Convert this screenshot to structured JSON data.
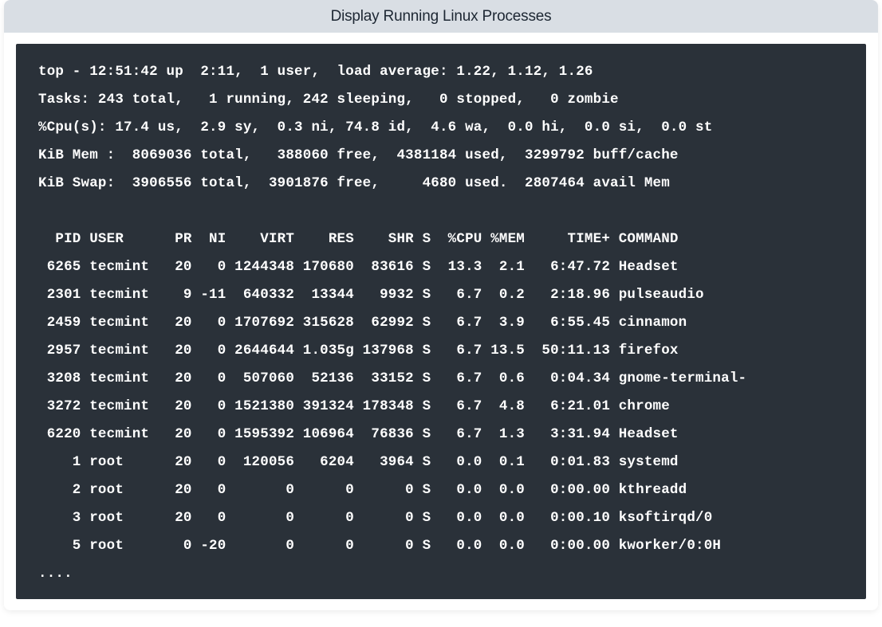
{
  "header": {
    "title": "Display Running Linux Processes"
  },
  "terminal": {
    "summary": {
      "line1": "top - 12:51:42 up  2:11,  1 user,  load average: 1.22, 1.12, 1.26",
      "line2": "Tasks: 243 total,   1 running, 242 sleeping,   0 stopped,   0 zombie",
      "line3": "%Cpu(s): 17.4 us,  2.9 sy,  0.3 ni, 74.8 id,  4.6 wa,  0.0 hi,  0.0 si,  0.0 st",
      "line4": "KiB Mem :  8069036 total,   388060 free,  4381184 used,  3299792 buff/cache",
      "line5": "KiB Swap:  3906556 total,  3901876 free,     4680 used.  2807464 avail Mem"
    },
    "columns": [
      "PID",
      "USER",
      "PR",
      "NI",
      "VIRT",
      "RES",
      "SHR",
      "S",
      "%CPU",
      "%MEM",
      "TIME+",
      "COMMAND"
    ],
    "header_row": "  PID USER      PR  NI    VIRT    RES    SHR S  %CPU %MEM     TIME+ COMMAND",
    "processes": [
      {
        "pid": 6265,
        "user": "tecmint",
        "pr": 20,
        "ni": 0,
        "virt": "1244348",
        "res": "170680",
        "shr": "83616",
        "s": "S",
        "cpu": "13.3",
        "mem": "2.1",
        "time": "6:47.72",
        "command": "Headset"
      },
      {
        "pid": 2301,
        "user": "tecmint",
        "pr": 9,
        "ni": -11,
        "virt": "640332",
        "res": "13344",
        "shr": "9932",
        "s": "S",
        "cpu": "6.7",
        "mem": "0.2",
        "time": "2:18.96",
        "command": "pulseaudio"
      },
      {
        "pid": 2459,
        "user": "tecmint",
        "pr": 20,
        "ni": 0,
        "virt": "1707692",
        "res": "315628",
        "shr": "62992",
        "s": "S",
        "cpu": "6.7",
        "mem": "3.9",
        "time": "6:55.45",
        "command": "cinnamon"
      },
      {
        "pid": 2957,
        "user": "tecmint",
        "pr": 20,
        "ni": 0,
        "virt": "2644644",
        "res": "1.035g",
        "shr": "137968",
        "s": "S",
        "cpu": "6.7",
        "mem": "13.5",
        "time": "50:11.13",
        "command": "firefox"
      },
      {
        "pid": 3208,
        "user": "tecmint",
        "pr": 20,
        "ni": 0,
        "virt": "507060",
        "res": "52136",
        "shr": "33152",
        "s": "S",
        "cpu": "6.7",
        "mem": "0.6",
        "time": "0:04.34",
        "command": "gnome-terminal-"
      },
      {
        "pid": 3272,
        "user": "tecmint",
        "pr": 20,
        "ni": 0,
        "virt": "1521380",
        "res": "391324",
        "shr": "178348",
        "s": "S",
        "cpu": "6.7",
        "mem": "4.8",
        "time": "6:21.01",
        "command": "chrome"
      },
      {
        "pid": 6220,
        "user": "tecmint",
        "pr": 20,
        "ni": 0,
        "virt": "1595392",
        "res": "106964",
        "shr": "76836",
        "s": "S",
        "cpu": "6.7",
        "mem": "1.3",
        "time": "3:31.94",
        "command": "Headset"
      },
      {
        "pid": 1,
        "user": "root",
        "pr": 20,
        "ni": 0,
        "virt": "120056",
        "res": "6204",
        "shr": "3964",
        "s": "S",
        "cpu": "0.0",
        "mem": "0.1",
        "time": "0:01.83",
        "command": "systemd"
      },
      {
        "pid": 2,
        "user": "root",
        "pr": 20,
        "ni": 0,
        "virt": "0",
        "res": "0",
        "shr": "0",
        "s": "S",
        "cpu": "0.0",
        "mem": "0.0",
        "time": "0:00.00",
        "command": "kthreadd"
      },
      {
        "pid": 3,
        "user": "root",
        "pr": 20,
        "ni": 0,
        "virt": "0",
        "res": "0",
        "shr": "0",
        "s": "S",
        "cpu": "0.0",
        "mem": "0.0",
        "time": "0:00.10",
        "command": "ksoftirqd/0"
      },
      {
        "pid": 5,
        "user": "root",
        "pr": 0,
        "ni": -20,
        "virt": "0",
        "res": "0",
        "shr": "0",
        "s": "S",
        "cpu": "0.0",
        "mem": "0.0",
        "time": "0:00.00",
        "command": "kworker/0:0H"
      }
    ],
    "ellipsis": "...."
  }
}
